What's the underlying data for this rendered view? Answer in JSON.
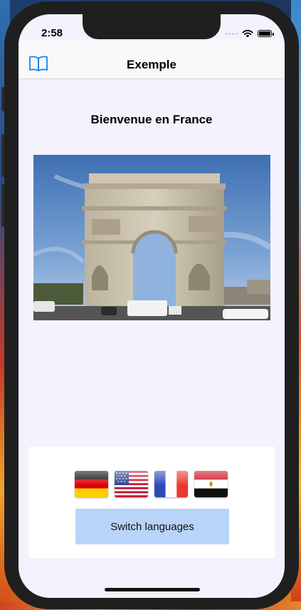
{
  "status_bar": {
    "time": "2:58",
    "icons": [
      "signal-dots-icon",
      "wifi-icon",
      "battery-icon"
    ]
  },
  "navbar": {
    "title": "Exemple",
    "left_icon": "book-icon"
  },
  "main": {
    "heading": "Bienvenue en France",
    "image": "arc-de-triomphe-photo"
  },
  "languages": {
    "flags": [
      "germany-flag-icon",
      "usa-flag-icon",
      "france-flag-icon",
      "egypt-flag-icon"
    ],
    "switch_label": "Switch languages"
  },
  "colors": {
    "screen_background": "#f5f2fd",
    "button_background": "#b8d4f9",
    "accent_blue": "#1e7cf4"
  }
}
